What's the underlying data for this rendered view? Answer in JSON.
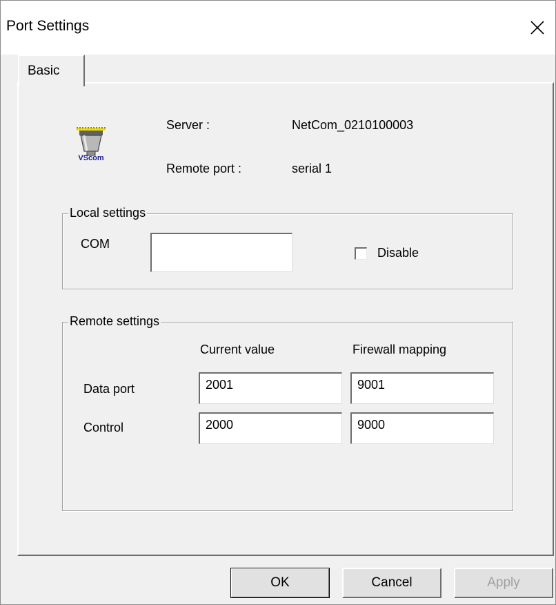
{
  "window": {
    "title": "Port Settings"
  },
  "tabs": [
    {
      "label": "Basic"
    }
  ],
  "icon": {
    "name": "vscom-serial-port-icon",
    "text": "VScom"
  },
  "server": {
    "label": "Server :",
    "value": "NetCom_0210100003"
  },
  "remote_port": {
    "label": "Remote port :",
    "value": "serial 1"
  },
  "local_settings": {
    "title": "Local settings",
    "com_label": "COM",
    "com_value": "",
    "disable_label": "Disable",
    "disable_checked": false
  },
  "remote_settings": {
    "title": "Remote settings",
    "col_current": "Current value",
    "col_firewall": "Firewall mapping",
    "rows": [
      {
        "label": "Data port",
        "current": "2001",
        "firewall": "9001"
      },
      {
        "label": "Control",
        "current": "2000",
        "firewall": "9000"
      }
    ]
  },
  "buttons": {
    "ok": "OK",
    "cancel": "Cancel",
    "apply": "Apply"
  }
}
